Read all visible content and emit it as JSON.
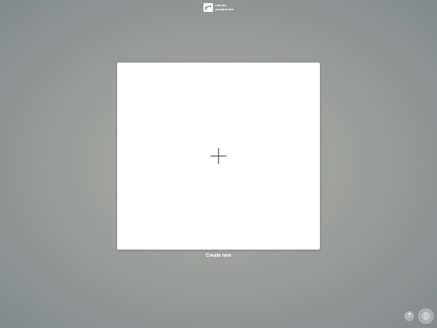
{
  "header": {
    "logo_icon": "infinite-peripherals-logo-icon",
    "logo_line1": "infinite",
    "logo_line2": "peripherals"
  },
  "main": {
    "create_icon": "plus-icon",
    "create_label": "Create new"
  },
  "footer": {
    "help_label": "?",
    "help_icon": "question-icon",
    "settings_icon": "gear-icon"
  },
  "colors": {
    "background": "#9fa19e",
    "card": "#ffffff",
    "text": "#ffffff",
    "icon": "#333333"
  }
}
